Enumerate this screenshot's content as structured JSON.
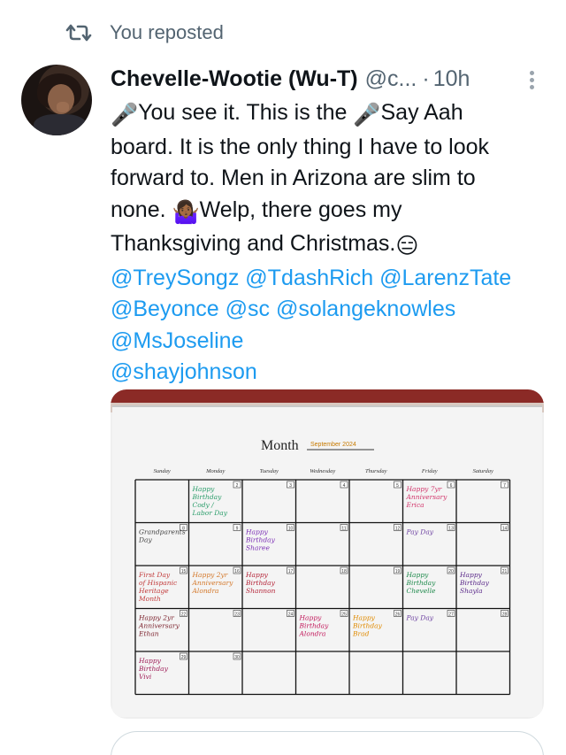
{
  "repost": {
    "label": "You reposted",
    "icon": "repost-icon"
  },
  "author": {
    "display_name": "Chevelle-Wootie (Wu-T)",
    "handle": "@c...",
    "separator": "·",
    "time": "10h"
  },
  "tweet": {
    "lines": [
      {
        "prefix": "🎤",
        "text": "You see it. This is the ",
        "mid": "🎤",
        "tail": "Say Aah"
      },
      {
        "text": "board. It is the only thing I have to look"
      },
      {
        "text": "forward to. Men in Arizona are slim to"
      },
      {
        "text": "none. ",
        "emoji": "🤷🏾‍♀️",
        "tail": "Welp, there goes my"
      },
      {
        "text": "Thanksgiving and Christmas.",
        "emoji": "😑"
      }
    ],
    "mentions": [
      [
        "@TreySongz",
        "@TdashRich",
        "@LarenzTate"
      ],
      [
        "@Beyonce",
        "@sc",
        "@solangeknowles"
      ],
      [
        "@MsJoseline"
      ],
      [
        "@shayjohnson"
      ]
    ]
  },
  "calendar": {
    "month_label": "Month",
    "month_value": "September 2024",
    "weekdays": [
      "Sunday",
      "Monday",
      "Tuesday",
      "Wednesday",
      "Thursday",
      "Friday",
      "Saturday"
    ],
    "rows": [
      [
        {
          "day": "",
          "text": ""
        },
        {
          "day": "2",
          "text": "Happy Birthday Cody / Labor Day",
          "color": "#2a9d6a"
        },
        {
          "day": "3",
          "text": ""
        },
        {
          "day": "4",
          "text": ""
        },
        {
          "day": "5",
          "text": ""
        },
        {
          "day": "6",
          "text": "Happy 7yr Anniversary Erica",
          "color": "#d2356b"
        },
        {
          "day": "7",
          "text": ""
        }
      ],
      [
        {
          "day": "8",
          "text": "Grandparents Day",
          "color": "#444444"
        },
        {
          "day": "9",
          "text": ""
        },
        {
          "day": "10",
          "text": "Happy Birthday Sharee",
          "color": "#7b2fb5"
        },
        {
          "day": "11",
          "text": ""
        },
        {
          "day": "12",
          "text": ""
        },
        {
          "day": "13",
          "text": "Pay Day",
          "color": "#6b3fa0"
        },
        {
          "day": "14",
          "text": ""
        }
      ],
      [
        {
          "day": "15",
          "text": "First Day of Hispanic Heritage Month",
          "color": "#c23b3b"
        },
        {
          "day": "16",
          "text": "Happy 2yr Anniversary Alondra",
          "color": "#d4782a"
        },
        {
          "day": "17",
          "text": "Happy Birthday Shannon",
          "color": "#b5263a"
        },
        {
          "day": "18",
          "text": ""
        },
        {
          "day": "19",
          "text": ""
        },
        {
          "day": "20",
          "text": "Happy Birthday Chevelle",
          "color": "#1f8a4c"
        },
        {
          "day": "21",
          "text": "Happy Birthday Shayla",
          "color": "#5b2a8a"
        }
      ],
      [
        {
          "day": "22",
          "text": "Happy 2yr Anniversary Ethan",
          "color": "#7a1f2a"
        },
        {
          "day": "23",
          "text": ""
        },
        {
          "day": "24",
          "text": ""
        },
        {
          "day": "25",
          "text": "Happy Birthday Alondra",
          "color": "#c2185b"
        },
        {
          "day": "26",
          "text": "Happy Birthday Brad",
          "color": "#e08a00"
        },
        {
          "day": "27",
          "text": "Pay Day",
          "color": "#6b3fa0"
        },
        {
          "day": "28",
          "text": ""
        }
      ],
      [
        {
          "day": "29",
          "text": "Happy Birthday Vivi",
          "color": "#a0205a"
        },
        {
          "day": "30",
          "text": ""
        },
        {
          "day": "",
          "text": ""
        },
        {
          "day": "",
          "text": ""
        },
        {
          "day": "",
          "text": ""
        },
        {
          "day": "",
          "text": ""
        },
        {
          "day": "",
          "text": ""
        }
      ]
    ]
  }
}
